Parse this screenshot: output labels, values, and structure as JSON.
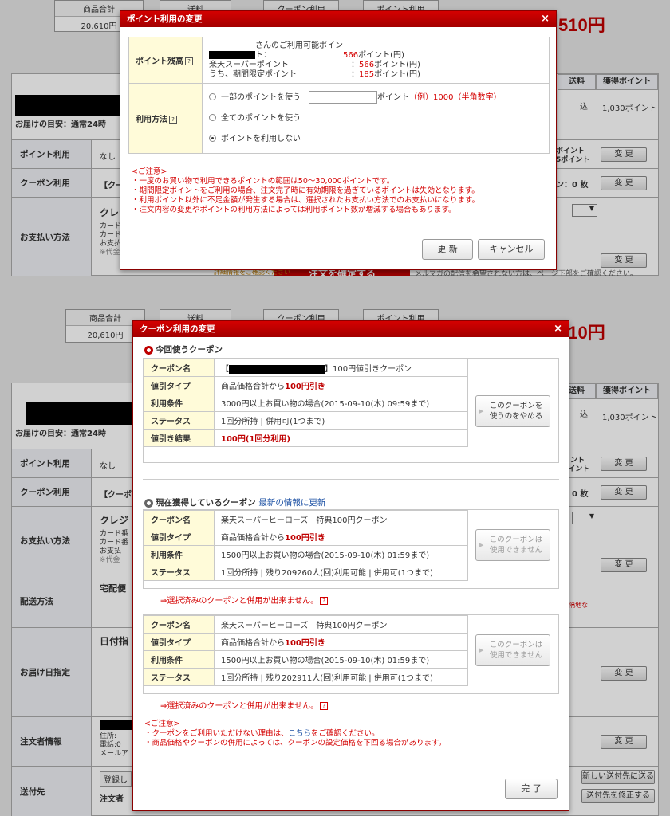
{
  "page": {
    "summary_headers": [
      "商品合計",
      "送料",
      "クーポン利用",
      "ポイント利用"
    ],
    "subtotal_value": "20,610円",
    "total_partial": "510円",
    "col_shipping": "送料",
    "col_points": "獲得ポイント",
    "shipping_value": "込",
    "points_value": "1,030ポイント",
    "delivery_guide": "お届けの目安：通常24時",
    "rows": {
      "point_use": "ポイント利用",
      "point_use_value": "なし",
      "coupon_use": "クーポン利用",
      "coupon_use_value": "【クーポ",
      "payment": "お支払い方法",
      "payment_value": "クレジ",
      "payment_sub1": "カード番",
      "payment_sub2": "カード番",
      "payment_sub3": "お支払",
      "payment_sub4": "※代金",
      "delivery_method": "配送方法",
      "delivery_method_value": "宅配便",
      "delivery_date": "お届け日指定",
      "delivery_date_value": "日付指",
      "orderer": "注文者情報",
      "orderer_sub1": "住所:",
      "orderer_sub2": "電話:0",
      "orderer_sub3": "メールア",
      "ship_to": "送付先",
      "ship_to_value": "注文者",
      "registered": "登録し"
    },
    "right_snip_point": "ポイント",
    "right_snip_point2": "5ポイント",
    "right_snip_coupon": "ン：0 枚",
    "change_label": "変 更",
    "confirm_button": "注文を確定する",
    "confirm_note": "メルマガの配信を希望されない方は、ページ下部をご確認ください。",
    "partial_link": "詳細情報をご確認ください",
    "remote_note": "遠隔地な",
    "new_address_button": "新しい送付先に送る",
    "edit_address_button": "送付先を修正する",
    "dash": "▼"
  },
  "point_modal": {
    "title": "ポイント利用の変更",
    "close": "×",
    "balance_label": "ポイント残高",
    "available_line": "さんのご利用可能ポイント：",
    "available_value": "566",
    "unit": "ポイント(円)",
    "rakuten_label": "楽天スーパーポイント",
    "rakuten_value": "566",
    "limited_label": "うち、期間限定ポイント",
    "limited_value": "185",
    "method_label": "利用方法",
    "options": {
      "partial": "一部のポイントを使う",
      "all": "全てのポイントを使う",
      "none": "ポイントを利用しない"
    },
    "input_suffix": "ポイント",
    "input_example": "（例）1000（半角数字）",
    "notes": [
      "<ご注意>",
      "・一度のお買い物で利用できるポイントの範囲は50～30,000ポイントです。",
      "・期間限定ポイントをご利用の場合、注文完了時に有効期限を過ぎているポイントは失効となります。",
      "・利用ポイント以外に不足金額が発生する場合は、選択されたお支払い方法でのお支払いになります。",
      "・注文内容の変更やポイントの利用方法によっては利用ポイント数が増減する場合もあります。"
    ],
    "update_button": "更 新",
    "cancel_button": "キャンセル"
  },
  "coupon_modal": {
    "title": "クーポン利用の変更",
    "close": "×",
    "current_heading": "今回使うクーポン",
    "current": {
      "name_label": "クーポン名",
      "name_prefix": "【",
      "name_suffix": "】100円値引きクーポン",
      "type_label": "値引タイプ",
      "type_value": "商品価格合計から",
      "type_amount": "100円引き",
      "cond_label": "利用条件",
      "cond_value": "3000円以上お買い物の場合(2015-09-10(木) 09:59まで)",
      "status_label": "ステータス",
      "status_value": "1回分所持 | 併用可(1つまで)",
      "result_label": "値引き結果",
      "result_value": "100円(1回分利用)",
      "button_line1": "このクーポンを",
      "button_line2": "使うのをやめる"
    },
    "acquired_heading": "現在獲得しているクーポン",
    "refresh_link": "最新の情報に更新",
    "acquired": [
      {
        "name_label": "クーポン名",
        "name": "楽天スーパーヒーローズ　特典100円クーポン",
        "type_label": "値引タイプ",
        "type_value": "商品価格合計から",
        "type_amount": "100円引き",
        "cond_label": "利用条件",
        "cond_value": "1500円以上お買い物の場合(2015-09-10(木) 01:59まで)",
        "status_label": "ステータス",
        "status_value": "1回分所持 | 残り209260人(回)利用可能 | 併用可(1つまで)",
        "button_line1": "このクーポンは",
        "button_line2": "使用できません",
        "warning": "⇒選択済みのクーポンと併用が出来ません。"
      },
      {
        "name_label": "クーポン名",
        "name": "楽天スーパーヒーローズ　特典100円クーポン",
        "type_label": "値引タイプ",
        "type_value": "商品価格合計から",
        "type_amount": "100円引き",
        "cond_label": "利用条件",
        "cond_value": "1500円以上お買い物の場合(2015-09-10(木) 01:59まで)",
        "status_label": "ステータス",
        "status_value": "1回分所持 | 残り202911人(回)利用可能 | 併用可(1つまで)",
        "button_line1": "このクーポンは",
        "button_line2": "使用できません",
        "warning": "⇒選択済みのクーポンと併用が出来ません。"
      }
    ],
    "notes_head": "<ご注意>",
    "note1_pre": "・クーポンをご利用いただけない理由は、",
    "note1_link": "こちら",
    "note1_post": "をご確認ください。",
    "note2": "・商品価格やクーポンの併用によっては、クーポンの設定価格を下回る場合があります。",
    "done_button": "完 了"
  }
}
